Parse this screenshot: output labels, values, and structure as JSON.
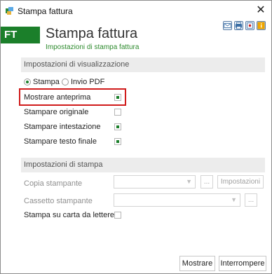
{
  "window": {
    "title": "Stampa fattura"
  },
  "header": {
    "badge": "FT",
    "title": "Stampa fattura",
    "subtitle": "Impostazioni di stampa fattura"
  },
  "toolbar_icons": [
    "email-icon",
    "print-icon",
    "record-icon",
    "info-icon"
  ],
  "display_section": {
    "title": "Impostazioni di visualizzazione",
    "radio_options": [
      {
        "label": "Stampa",
        "selected": true
      },
      {
        "label": "Invio PDF",
        "selected": false
      }
    ],
    "options": [
      {
        "label": "Mostrare anteprima",
        "checked": true
      },
      {
        "label": "Stampare originale",
        "checked": false
      },
      {
        "label": "Stampare intestazione",
        "checked": true
      },
      {
        "label": "Stampare testo finale",
        "checked": true
      }
    ]
  },
  "print_section": {
    "title": "Impostazioni di stampa",
    "fields": [
      {
        "label": "Copia stampante",
        "value": "",
        "browse_label": "...",
        "extra_button": "Impostazioni"
      },
      {
        "label": "Cassetto stampante",
        "value": "",
        "browse_label": "..."
      }
    ],
    "letterhead": {
      "label": "Stampa su carta da lettere",
      "checked": false
    }
  },
  "footer": {
    "show_button": "Mostrare",
    "cancel_button": "Interrompere"
  },
  "colors": {
    "accent": "#1b7f2a",
    "highlight": "#d01b1b"
  }
}
